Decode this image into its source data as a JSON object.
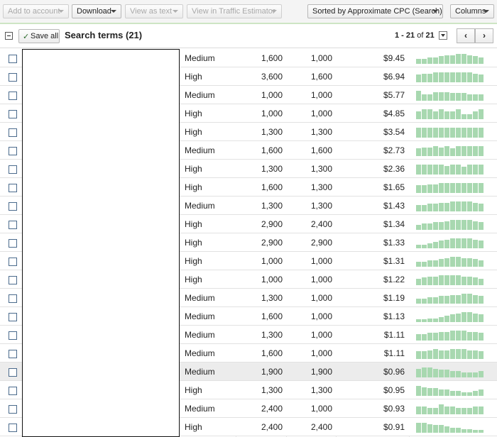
{
  "toolbar": {
    "add_to_account": "Add to account",
    "download": "Download",
    "view_as_text": "View as text",
    "view_in_traffic_estimator": "View in Traffic Estimator",
    "sorted_by": "Sorted by Approximate CPC (Search)",
    "columns": "Columns"
  },
  "header": {
    "save_all": "Save all",
    "title": "Search terms (21)",
    "pager_range": "1 - 21",
    "pager_of": "of",
    "pager_total": "21",
    "prev": "‹",
    "next": "›"
  },
  "colors": {
    "spark_bar": "#a8d8b0",
    "row_highlight": "#ececec",
    "toolbar_border": "#cde5c4"
  },
  "rows": [
    {
      "competition": "Medium",
      "global": "1,600",
      "local": "1,000",
      "cpc": "$9.45",
      "trend": [
        4,
        4,
        5,
        5,
        6,
        7,
        7,
        8,
        8,
        7,
        6,
        5
      ]
    },
    {
      "competition": "High",
      "global": "3,600",
      "local": "1,600",
      "cpc": "$6.94",
      "trend": [
        6,
        7,
        7,
        8,
        8,
        8,
        8,
        8,
        8,
        8,
        7,
        6
      ]
    },
    {
      "competition": "Medium",
      "global": "1,000",
      "local": "1,000",
      "cpc": "$5.77",
      "trend": [
        8,
        5,
        5,
        7,
        7,
        7,
        6,
        6,
        6,
        5,
        5,
        5
      ]
    },
    {
      "competition": "High",
      "global": "1,000",
      "local": "1,000",
      "cpc": "$4.85",
      "trend": [
        6,
        8,
        8,
        6,
        8,
        6,
        6,
        8,
        4,
        4,
        6,
        8
      ]
    },
    {
      "competition": "High",
      "global": "1,300",
      "local": "1,300",
      "cpc": "$3.54",
      "trend": [
        8,
        8,
        8,
        8,
        8,
        8,
        8,
        8,
        8,
        8,
        8,
        8
      ]
    },
    {
      "competition": "Medium",
      "global": "1,600",
      "local": "1,600",
      "cpc": "$2.73",
      "trend": [
        6,
        7,
        7,
        8,
        7,
        8,
        6,
        8,
        8,
        8,
        8,
        8
      ]
    },
    {
      "competition": "High",
      "global": "1,300",
      "local": "1,300",
      "cpc": "$2.36",
      "trend": [
        8,
        8,
        8,
        8,
        8,
        7,
        8,
        8,
        6,
        8,
        8,
        8
      ]
    },
    {
      "competition": "High",
      "global": "1,600",
      "local": "1,300",
      "cpc": "$1.65",
      "trend": [
        6,
        6,
        7,
        7,
        8,
        8,
        8,
        8,
        8,
        8,
        8,
        8
      ]
    },
    {
      "competition": "Medium",
      "global": "1,300",
      "local": "1,300",
      "cpc": "$1.43",
      "trend": [
        5,
        5,
        6,
        6,
        7,
        7,
        8,
        8,
        8,
        8,
        7,
        6
      ]
    },
    {
      "competition": "High",
      "global": "2,900",
      "local": "2,400",
      "cpc": "$1.34",
      "trend": [
        4,
        5,
        5,
        6,
        6,
        7,
        8,
        8,
        8,
        8,
        7,
        6
      ]
    },
    {
      "competition": "High",
      "global": "2,900",
      "local": "2,900",
      "cpc": "$1.33",
      "trend": [
        3,
        3,
        4,
        5,
        6,
        7,
        8,
        8,
        8,
        8,
        7,
        6
      ]
    },
    {
      "competition": "High",
      "global": "1,000",
      "local": "1,000",
      "cpc": "$1.31",
      "trend": [
        4,
        4,
        5,
        5,
        6,
        7,
        8,
        8,
        7,
        7,
        6,
        5
      ]
    },
    {
      "competition": "High",
      "global": "1,000",
      "local": "1,000",
      "cpc": "$1.22",
      "trend": [
        5,
        6,
        7,
        7,
        8,
        8,
        8,
        8,
        7,
        7,
        6,
        5
      ]
    },
    {
      "competition": "Medium",
      "global": "1,300",
      "local": "1,000",
      "cpc": "$1.19",
      "trend": [
        4,
        4,
        5,
        5,
        6,
        6,
        7,
        7,
        8,
        8,
        7,
        6
      ]
    },
    {
      "competition": "Medium",
      "global": "1,600",
      "local": "1,000",
      "cpc": "$1.13",
      "trend": [
        2,
        2,
        3,
        3,
        4,
        5,
        6,
        7,
        8,
        8,
        7,
        6
      ]
    },
    {
      "competition": "Medium",
      "global": "1,300",
      "local": "1,000",
      "cpc": "$1.11",
      "trend": [
        5,
        5,
        6,
        6,
        7,
        7,
        8,
        8,
        8,
        7,
        7,
        6
      ]
    },
    {
      "competition": "Medium",
      "global": "1,600",
      "local": "1,000",
      "cpc": "$1.11",
      "trend": [
        6,
        6,
        7,
        8,
        7,
        7,
        8,
        8,
        8,
        7,
        7,
        6
      ]
    },
    {
      "competition": "Medium",
      "global": "1,900",
      "local": "1,900",
      "cpc": "$0.96",
      "trend": [
        7,
        8,
        8,
        7,
        6,
        6,
        5,
        5,
        4,
        4,
        4,
        5
      ]
    },
    {
      "competition": "High",
      "global": "1,300",
      "local": "1,300",
      "cpc": "$0.95",
      "trend": [
        8,
        7,
        6,
        6,
        5,
        5,
        4,
        4,
        3,
        3,
        4,
        5
      ]
    },
    {
      "competition": "Medium",
      "global": "2,400",
      "local": "1,000",
      "cpc": "$0.93",
      "trend": [
        6,
        6,
        5,
        5,
        8,
        6,
        6,
        5,
        5,
        5,
        6,
        6
      ]
    },
    {
      "competition": "High",
      "global": "2,400",
      "local": "2,400",
      "cpc": "$0.91",
      "trend": [
        8,
        8,
        7,
        6,
        6,
        5,
        4,
        4,
        3,
        3,
        2,
        2
      ]
    }
  ]
}
